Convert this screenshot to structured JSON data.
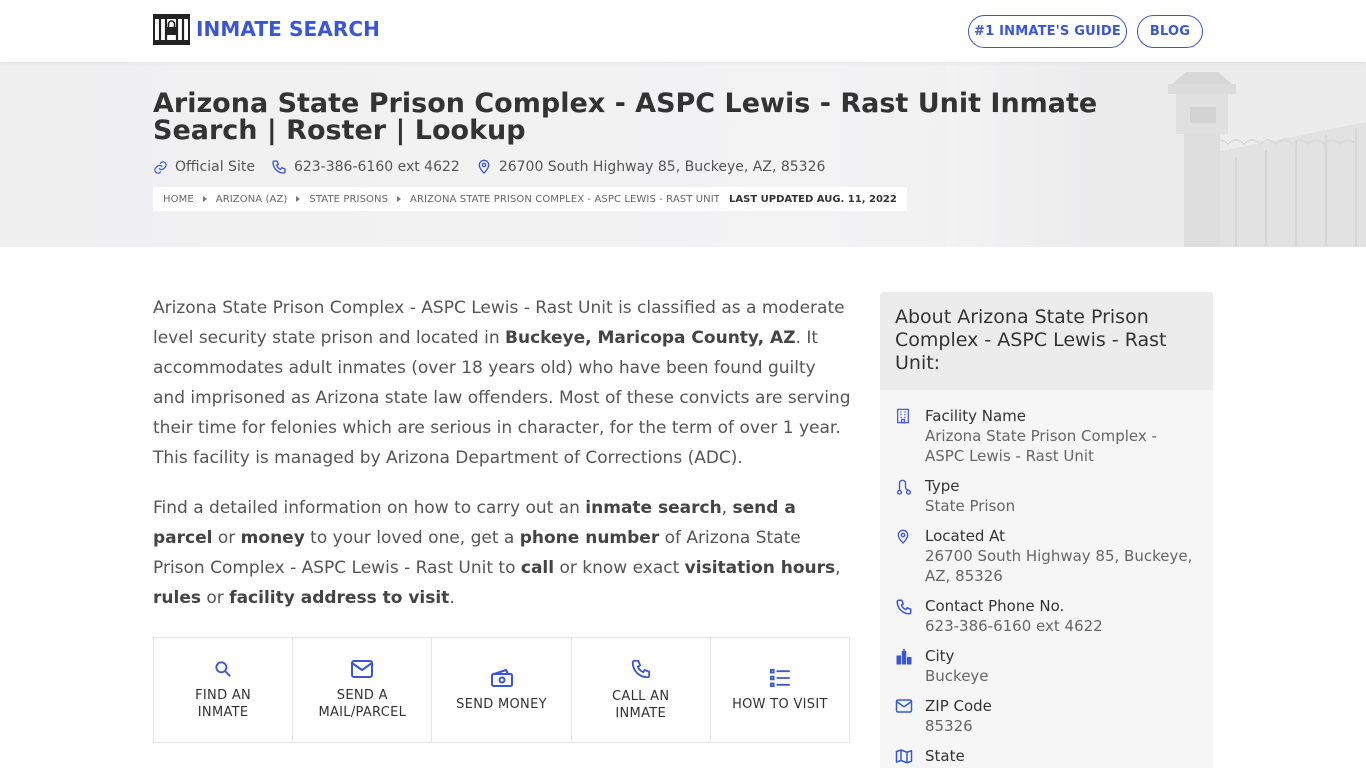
{
  "header": {
    "brand": "INMATE SEARCH",
    "guide_button": "#1 INMATE'S GUIDE",
    "blog_button": "BLOG"
  },
  "hero": {
    "title": "Arizona State Prison Complex - ASPC Lewis - Rast Unit Inmate Search | Roster | Lookup",
    "official_site": "Official Site",
    "phone": "623-386-6160 ext 4622",
    "address": "26700 South Highway 85, Buckeye, AZ, 85326",
    "breadcrumb": [
      "HOME",
      "ARIZONA (AZ)",
      "STATE PRISONS",
      "ARIZONA STATE PRISON COMPLEX - ASPC LEWIS - RAST UNIT"
    ],
    "last_updated": "LAST UPDATED AUG. 11, 2022"
  },
  "intro": {
    "p1_a": "Arizona State Prison Complex - ASPC Lewis - Rast Unit is classified as a moderate level security state prison and located in ",
    "p1_b": "Buckeye, Maricopa County, AZ",
    "p1_c": ". It accommodates adult inmates (over 18 years old) who have been found guilty and imprisoned as Arizona state law offenders. Most of these convicts are serving their time for felonies which are serious in character, for the term of over 1 year. This facility is managed by Arizona Department of Corrections (ADC).",
    "p2": [
      {
        "t": "Find a detailed information on how to carry out an ",
        "b": false
      },
      {
        "t": "inmate search",
        "b": true
      },
      {
        "t": ", ",
        "b": false
      },
      {
        "t": "send a parcel",
        "b": true
      },
      {
        "t": " or ",
        "b": false
      },
      {
        "t": "money",
        "b": true
      },
      {
        "t": " to your loved one, get a ",
        "b": false
      },
      {
        "t": "phone number",
        "b": true
      },
      {
        "t": " of Arizona State Prison Complex - ASPC Lewis - Rast Unit to ",
        "b": false
      },
      {
        "t": "call",
        "b": true
      },
      {
        "t": " or know exact ",
        "b": false
      },
      {
        "t": "visitation hours",
        "b": true
      },
      {
        "t": ", ",
        "b": false
      },
      {
        "t": "rules",
        "b": true
      },
      {
        "t": " or ",
        "b": false
      },
      {
        "t": "facility address to visit",
        "b": true
      },
      {
        "t": ".",
        "b": false
      }
    ]
  },
  "actions": [
    {
      "icon": "search-icon",
      "label_1": "FIND AN",
      "label_2": "INMATE"
    },
    {
      "icon": "mail-icon",
      "label_1": "SEND A",
      "label_2": "MAIL/PARCEL"
    },
    {
      "icon": "money-icon",
      "label_1": "SEND MONEY",
      "label_2": ""
    },
    {
      "icon": "phone-icon",
      "label_1": "CALL AN",
      "label_2": "INMATE"
    },
    {
      "icon": "list-icon",
      "label_1": "HOW TO VISIT",
      "label_2": ""
    }
  ],
  "sidebar": {
    "heading": "About Arizona State Prison Complex - ASPC Lewis - Rast Unit:",
    "items": [
      {
        "icon": "building-icon",
        "label": "Facility Name",
        "value": "Arizona State Prison Complex - ASPC Lewis - Rast Unit"
      },
      {
        "icon": "route-icon",
        "label": "Type",
        "value": "State Prison"
      },
      {
        "icon": "map-pin-icon",
        "label": "Located At",
        "value": "26700 South Highway 85, Buckeye, AZ, 85326"
      },
      {
        "icon": "phone-icon",
        "label": "Contact Phone No.",
        "value": "623-386-6160 ext 4622"
      },
      {
        "icon": "city-icon",
        "label": "City",
        "value": "Buckeye"
      },
      {
        "icon": "envelope-icon",
        "label": "ZIP Code",
        "value": "85326"
      },
      {
        "icon": "map-icon",
        "label": "State",
        "value": ""
      }
    ]
  },
  "colors": {
    "accent": "#3a56d4",
    "text": "#444444",
    "hero_bg": "#f1f1f2"
  }
}
